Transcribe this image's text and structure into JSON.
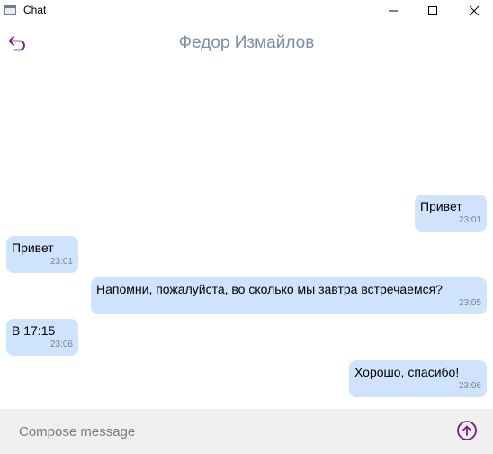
{
  "window": {
    "title": "Chat",
    "icons": {
      "app": "app-window-icon",
      "minimize": "minimize-icon",
      "maximize": "maximize-icon",
      "close": "close-icon"
    }
  },
  "header": {
    "contact_name": "Федор Измайлов",
    "back_icon": "back-arrow-icon"
  },
  "colors": {
    "bubble": "#cfe3fd",
    "accent": "#7a1d86",
    "name": "#7b8fa6",
    "compose_bg": "#efefef"
  },
  "messages": [
    {
      "direction": "outgoing",
      "text": "Привет",
      "time": "23:01"
    },
    {
      "direction": "incoming",
      "text": "Привет",
      "time": "23:01"
    },
    {
      "direction": "outgoing",
      "text": "Напомни, пожалуйста, во сколько мы завтра встречаемся?",
      "time": "23:05"
    },
    {
      "direction": "incoming",
      "text": "В 17:15",
      "time": "23:06"
    },
    {
      "direction": "outgoing",
      "text": "Хорошо, спасибо!",
      "time": "23:06"
    }
  ],
  "compose": {
    "placeholder": "Compose message",
    "value": "",
    "send_icon": "send-arrow-up-icon"
  }
}
